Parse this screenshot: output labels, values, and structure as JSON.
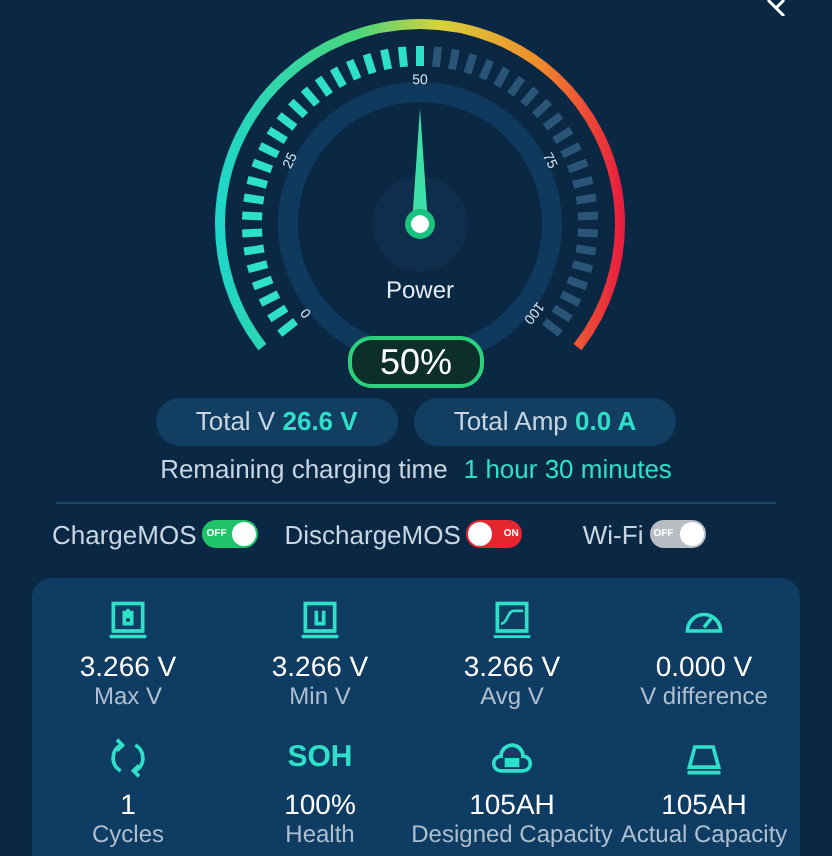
{
  "gauge": {
    "label": "Power",
    "reading": "50%",
    "ticks": [
      "0",
      "25",
      "50",
      "75",
      "100"
    ]
  },
  "totals": [
    {
      "label": "Total V",
      "value": "26.6 V"
    },
    {
      "label": "Total Amp",
      "value": "0.0 A"
    }
  ],
  "remaining": {
    "label": "Remaining charging time",
    "value": "1 hour 30 minutes"
  },
  "switches": [
    {
      "label": "ChargeMOS",
      "on": true,
      "text": "OFF",
      "color": "#1fc46a"
    },
    {
      "label": "DischargeMOS",
      "on": false,
      "text": "ON",
      "color": "#e5262f"
    },
    {
      "label": "Wi-Fi",
      "on": true,
      "text": "OFF",
      "color": "#b9bec4"
    }
  ],
  "stats": [
    {
      "kind": "maxv",
      "value": "3.266 V",
      "label": "Max V"
    },
    {
      "kind": "minv",
      "value": "3.266 V",
      "label": "Min V"
    },
    {
      "kind": "avgv",
      "value": "3.266 V",
      "label": "Avg V"
    },
    {
      "kind": "diff",
      "value": "0.000 V",
      "label": "V difference"
    },
    {
      "kind": "cycles",
      "value": "1",
      "label": "Cycles"
    },
    {
      "kind": "soh",
      "icon_text": "SOH",
      "value": "100%",
      "label": "Health"
    },
    {
      "kind": "cloud",
      "value": "105AH",
      "label": "Designed Capacity"
    },
    {
      "kind": "tray",
      "value": "105AH",
      "label": "Actual Capacity"
    }
  ]
}
